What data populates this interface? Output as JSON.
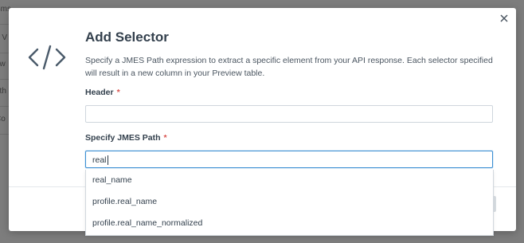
{
  "background": {
    "rows": [
      "Sms",
      "a V",
      "ow",
      "uth",
      "Co"
    ]
  },
  "modal": {
    "title": "Add Selector",
    "description": "Specify a JMES Path expression to extract a specific element from your API response. Each selector specified will result in a new column in your Preview table.",
    "header_field": {
      "label": "Header",
      "required_mark": "*",
      "value": ""
    },
    "jmes_field": {
      "label": "Specify JMES Path",
      "required_mark": "*",
      "value": "real"
    },
    "suggestions": [
      "real_name",
      "profile.real_name",
      "profile.real_name_normalized"
    ]
  },
  "icons": {
    "close": "close-icon",
    "code": "code-icon"
  },
  "colors": {
    "accent": "#3b8fd3",
    "required": "#d9534f",
    "text": "#33404d"
  }
}
